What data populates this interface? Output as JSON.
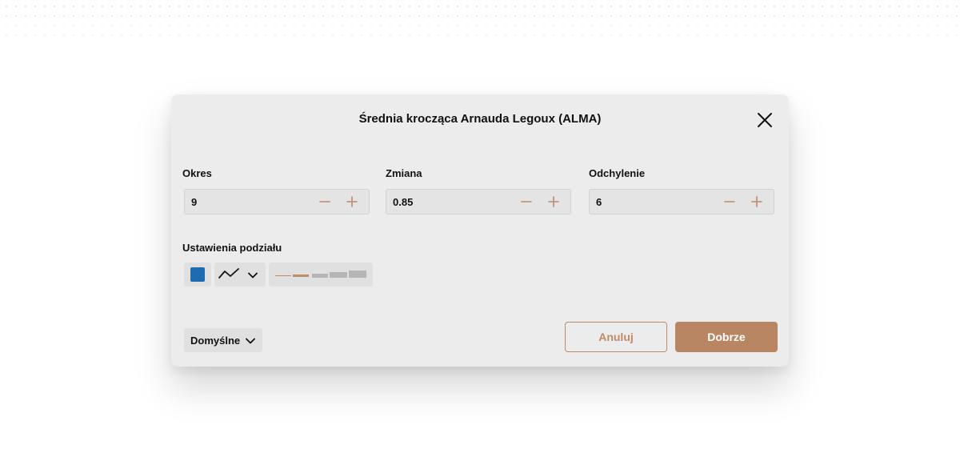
{
  "dialog": {
    "title": "Średnia krocząca Arnauda Legoux (ALMA)"
  },
  "icons": {
    "close": "close-icon",
    "minus": "minus-icon",
    "plus": "plus-icon",
    "line_style": "zigzag-line-icon",
    "dropdown": "chevron-down-icon"
  },
  "fields": [
    {
      "label": "Okres",
      "value": "9"
    },
    {
      "label": "Zmiana",
      "value": "0.85"
    },
    {
      "label": "Odchylenie",
      "value": "6"
    }
  ],
  "style": {
    "section_label": "Ustawienia podziału",
    "line_color": "#1f6bb0",
    "selected_thickness_level": 2,
    "thickness_levels": 5
  },
  "footer": {
    "defaults_label": "Domyślne",
    "cancel_label": "Anuluj",
    "ok_label": "Dobrze"
  },
  "colors": {
    "accent": "#bf8a68",
    "ok_background": "#b98663",
    "dialog_background": "#ececec"
  }
}
